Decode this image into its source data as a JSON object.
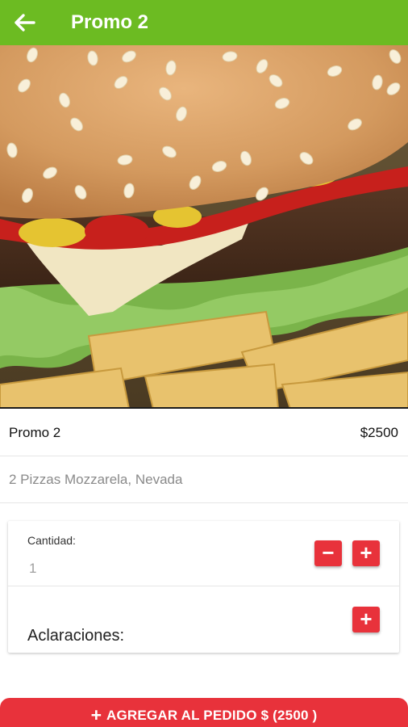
{
  "header": {
    "title": "Promo 2",
    "back_icon": "arrow-left-icon",
    "color": "#6cbb22"
  },
  "product": {
    "name": "Promo 2",
    "price": "$2500",
    "description": "2 Pizzas Mozzarela, Nevada"
  },
  "quantity": {
    "label": "Cantidad:",
    "value": "1",
    "minus": "−",
    "plus": "+"
  },
  "notes": {
    "label": "Aclaraciones:",
    "plus": "+"
  },
  "cta": {
    "plus": "+",
    "label": "AGREGAR AL PEDIDO $ (2500 )",
    "color": "#e8323b"
  }
}
